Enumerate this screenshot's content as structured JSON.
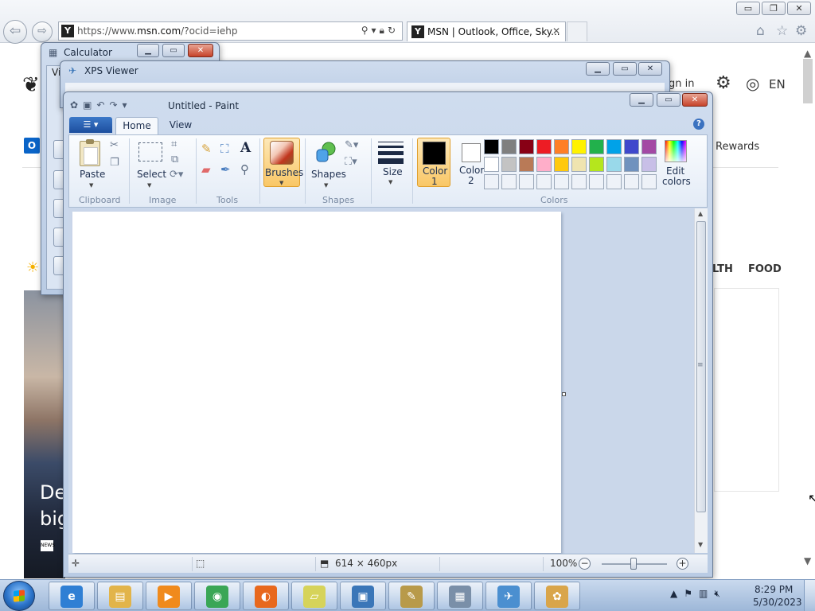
{
  "browser": {
    "url_prefix": "https://www.",
    "url_domain": "msn.com",
    "url_path": "/?ocid=iehp",
    "tab_title": "MSN | Outlook, Office, Sky...",
    "tab_close": "✕",
    "favicon_letter": "Y",
    "win_minimize": "▭",
    "win_restore": "❐",
    "win_close": "✕"
  },
  "msn_page": {
    "sign_in": "gn in",
    "lang": "EN",
    "rewards": "Rewards",
    "nav_health": "LTH",
    "nav_food": "FOOD",
    "headline": "De\nbig",
    "news_source": "NEWS",
    "outlook_letter": "O"
  },
  "calculator": {
    "title": "Calculator",
    "menu": "Vi"
  },
  "xps_viewer": {
    "title": "XPS Viewer"
  },
  "paint": {
    "title": "Untitled - Paint",
    "tabs": {
      "home": "Home",
      "view": "View"
    },
    "groups": {
      "clipboard": "Clipboard",
      "image": "Image",
      "tools": "Tools",
      "shapes": "Shapes",
      "colors": "Colors"
    },
    "buttons": {
      "paste": "Paste",
      "select": "Select",
      "brushes": "Brushes",
      "shapes": "Shapes",
      "size": "Size",
      "color1_line1": "Color",
      "color1_line2": "1",
      "color2_line1": "Color",
      "color2_line2": "2",
      "edit_colors_line1": "Edit",
      "edit_colors_line2": "colors"
    },
    "color1": "#000000",
    "color2": "#ffffff",
    "palette_row1": [
      "#000000",
      "#7f7f7f",
      "#880015",
      "#ed1c24",
      "#ff7f27",
      "#fff200",
      "#22b14c",
      "#00a2e8",
      "#3f48cc",
      "#a349a4"
    ],
    "palette_row2": [
      "#ffffff",
      "#c3c3c3",
      "#b97a57",
      "#ffaec9",
      "#ffc90e",
      "#efe4b0",
      "#b5e61d",
      "#99d9ea",
      "#7092be",
      "#c8bfe7"
    ],
    "status": {
      "canvas_size": "614 × 460px",
      "zoom": "100%"
    }
  },
  "taskbar": {
    "time": "8:29 PM",
    "date": "5/30/2023",
    "apps": [
      {
        "name": "internet-explorer",
        "color": "#2f7fd4",
        "glyph": "e"
      },
      {
        "name": "windows-explorer",
        "color": "#e2b44a",
        "glyph": "▤"
      },
      {
        "name": "media-player",
        "color": "#f08a1c",
        "glyph": "▶"
      },
      {
        "name": "chrome",
        "color": "#3aa655",
        "glyph": "◉"
      },
      {
        "name": "firefox",
        "color": "#e8681d",
        "glyph": "◐"
      },
      {
        "name": "sticky-notes",
        "color": "#d6d35a",
        "glyph": "▱"
      },
      {
        "name": "photo-viewer",
        "color": "#3a76b8",
        "glyph": "▣"
      },
      {
        "name": "tools-app",
        "color": "#b89a4a",
        "glyph": "✎"
      },
      {
        "name": "calculator",
        "color": "#7a8fa8",
        "glyph": "▦"
      },
      {
        "name": "xps-viewer",
        "color": "#4b8fd0",
        "glyph": "✈"
      },
      {
        "name": "paint",
        "color": "#d9a54a",
        "glyph": "✿"
      }
    ]
  }
}
